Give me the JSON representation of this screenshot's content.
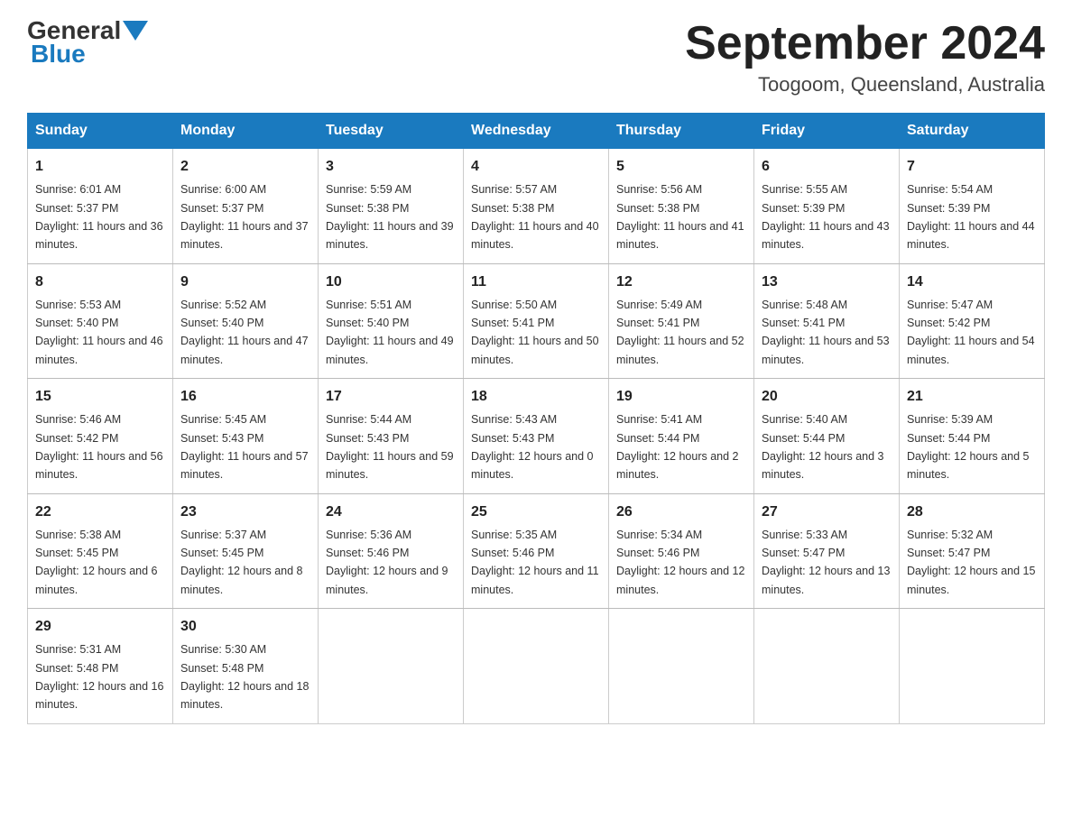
{
  "logo": {
    "text_general": "General",
    "text_blue": "Blue"
  },
  "header": {
    "month_year": "September 2024",
    "location": "Toogoom, Queensland, Australia"
  },
  "days_of_week": [
    "Sunday",
    "Monday",
    "Tuesday",
    "Wednesday",
    "Thursday",
    "Friday",
    "Saturday"
  ],
  "weeks": [
    [
      {
        "day": "1",
        "sunrise": "6:01 AM",
        "sunset": "5:37 PM",
        "daylight": "11 hours and 36 minutes."
      },
      {
        "day": "2",
        "sunrise": "6:00 AM",
        "sunset": "5:37 PM",
        "daylight": "11 hours and 37 minutes."
      },
      {
        "day": "3",
        "sunrise": "5:59 AM",
        "sunset": "5:38 PM",
        "daylight": "11 hours and 39 minutes."
      },
      {
        "day": "4",
        "sunrise": "5:57 AM",
        "sunset": "5:38 PM",
        "daylight": "11 hours and 40 minutes."
      },
      {
        "day": "5",
        "sunrise": "5:56 AM",
        "sunset": "5:38 PM",
        "daylight": "11 hours and 41 minutes."
      },
      {
        "day": "6",
        "sunrise": "5:55 AM",
        "sunset": "5:39 PM",
        "daylight": "11 hours and 43 minutes."
      },
      {
        "day": "7",
        "sunrise": "5:54 AM",
        "sunset": "5:39 PM",
        "daylight": "11 hours and 44 minutes."
      }
    ],
    [
      {
        "day": "8",
        "sunrise": "5:53 AM",
        "sunset": "5:40 PM",
        "daylight": "11 hours and 46 minutes."
      },
      {
        "day": "9",
        "sunrise": "5:52 AM",
        "sunset": "5:40 PM",
        "daylight": "11 hours and 47 minutes."
      },
      {
        "day": "10",
        "sunrise": "5:51 AM",
        "sunset": "5:40 PM",
        "daylight": "11 hours and 49 minutes."
      },
      {
        "day": "11",
        "sunrise": "5:50 AM",
        "sunset": "5:41 PM",
        "daylight": "11 hours and 50 minutes."
      },
      {
        "day": "12",
        "sunrise": "5:49 AM",
        "sunset": "5:41 PM",
        "daylight": "11 hours and 52 minutes."
      },
      {
        "day": "13",
        "sunrise": "5:48 AM",
        "sunset": "5:41 PM",
        "daylight": "11 hours and 53 minutes."
      },
      {
        "day": "14",
        "sunrise": "5:47 AM",
        "sunset": "5:42 PM",
        "daylight": "11 hours and 54 minutes."
      }
    ],
    [
      {
        "day": "15",
        "sunrise": "5:46 AM",
        "sunset": "5:42 PM",
        "daylight": "11 hours and 56 minutes."
      },
      {
        "day": "16",
        "sunrise": "5:45 AM",
        "sunset": "5:43 PM",
        "daylight": "11 hours and 57 minutes."
      },
      {
        "day": "17",
        "sunrise": "5:44 AM",
        "sunset": "5:43 PM",
        "daylight": "11 hours and 59 minutes."
      },
      {
        "day": "18",
        "sunrise": "5:43 AM",
        "sunset": "5:43 PM",
        "daylight": "12 hours and 0 minutes."
      },
      {
        "day": "19",
        "sunrise": "5:41 AM",
        "sunset": "5:44 PM",
        "daylight": "12 hours and 2 minutes."
      },
      {
        "day": "20",
        "sunrise": "5:40 AM",
        "sunset": "5:44 PM",
        "daylight": "12 hours and 3 minutes."
      },
      {
        "day": "21",
        "sunrise": "5:39 AM",
        "sunset": "5:44 PM",
        "daylight": "12 hours and 5 minutes."
      }
    ],
    [
      {
        "day": "22",
        "sunrise": "5:38 AM",
        "sunset": "5:45 PM",
        "daylight": "12 hours and 6 minutes."
      },
      {
        "day": "23",
        "sunrise": "5:37 AM",
        "sunset": "5:45 PM",
        "daylight": "12 hours and 8 minutes."
      },
      {
        "day": "24",
        "sunrise": "5:36 AM",
        "sunset": "5:46 PM",
        "daylight": "12 hours and 9 minutes."
      },
      {
        "day": "25",
        "sunrise": "5:35 AM",
        "sunset": "5:46 PM",
        "daylight": "12 hours and 11 minutes."
      },
      {
        "day": "26",
        "sunrise": "5:34 AM",
        "sunset": "5:46 PM",
        "daylight": "12 hours and 12 minutes."
      },
      {
        "day": "27",
        "sunrise": "5:33 AM",
        "sunset": "5:47 PM",
        "daylight": "12 hours and 13 minutes."
      },
      {
        "day": "28",
        "sunrise": "5:32 AM",
        "sunset": "5:47 PM",
        "daylight": "12 hours and 15 minutes."
      }
    ],
    [
      {
        "day": "29",
        "sunrise": "5:31 AM",
        "sunset": "5:48 PM",
        "daylight": "12 hours and 16 minutes."
      },
      {
        "day": "30",
        "sunrise": "5:30 AM",
        "sunset": "5:48 PM",
        "daylight": "12 hours and 18 minutes."
      },
      {
        "day": "",
        "sunrise": "",
        "sunset": "",
        "daylight": ""
      },
      {
        "day": "",
        "sunrise": "",
        "sunset": "",
        "daylight": ""
      },
      {
        "day": "",
        "sunrise": "",
        "sunset": "",
        "daylight": ""
      },
      {
        "day": "",
        "sunrise": "",
        "sunset": "",
        "daylight": ""
      },
      {
        "day": "",
        "sunrise": "",
        "sunset": "",
        "daylight": ""
      }
    ]
  ],
  "labels": {
    "sunrise": "Sunrise:",
    "sunset": "Sunset:",
    "daylight": "Daylight:"
  }
}
